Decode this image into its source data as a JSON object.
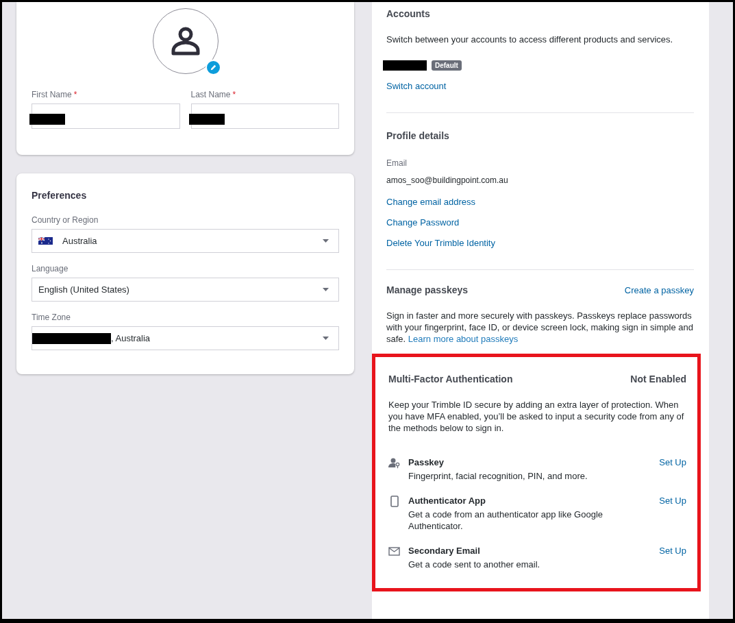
{
  "profile": {
    "required_mark": "*",
    "name_fields": [
      {
        "label": "First Name",
        "required": true,
        "redacted": true
      },
      {
        "label": "Last Name",
        "required": true,
        "redacted": true
      }
    ]
  },
  "preferences": {
    "title": "Preferences",
    "fields": [
      {
        "label": "Country or Region",
        "kind": "country",
        "value": "Australia"
      },
      {
        "label": "Language",
        "kind": "plain",
        "value": "English (United States)"
      },
      {
        "label": "Time Zone",
        "kind": "redacted",
        "value": ", Australia"
      }
    ]
  },
  "accounts": {
    "title": "Accounts",
    "description": "Switch between your accounts to access different products and services.",
    "account": {
      "redacted": true,
      "badge": "Default"
    },
    "link": "Switch account"
  },
  "profile_details": {
    "title": "Profile details",
    "email_label": "Email",
    "email": "amos_soo@buildingpoint.com.au",
    "links": [
      "Change email address",
      "Change Password",
      "Delete Your Trimble Identity"
    ]
  },
  "passkeys": {
    "title": "Manage passkeys",
    "action": "Create a passkey",
    "description": "Sign in faster and more securely with passkeys. Passkeys replace passwords with your fingerprint, face ID, or device screen lock, making sign in simple and safe.",
    "link": "Learn more about passkeys"
  },
  "mfa": {
    "title": "Multi-Factor Authentication",
    "status": "Not Enabled",
    "highlighted": true,
    "description": "Keep your Trimble ID secure by adding an extra layer of protection. When you have MFA enabled, you’ll be asked to input a security code from any of the methods below to sign in.",
    "methods": [
      {
        "kind": "passkey",
        "name": "Passkey",
        "description": "Fingerprint, facial recognition, PIN, and more.",
        "action": "Set Up"
      },
      {
        "kind": "app",
        "name": "Authenticator App",
        "description": "Get a code from an authenticator app like Google Authenticator.",
        "action": "Set Up"
      },
      {
        "kind": "email",
        "name": "Secondary Email",
        "description": "Get a code sent to another email.",
        "action": "Set Up"
      }
    ]
  }
}
